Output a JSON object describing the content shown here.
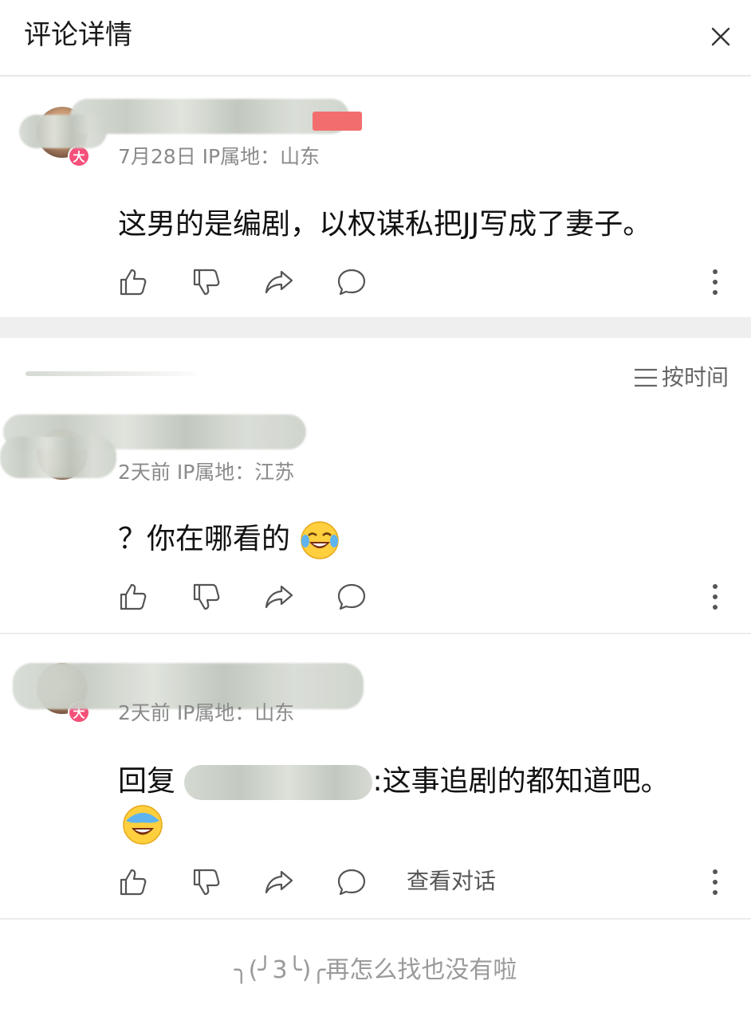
{
  "header": {
    "title": "评论详情"
  },
  "main_comment": {
    "meta": "7月28日 IP属地：山东",
    "text": "这男的是编剧，以权谋私把JJ写成了妻子。",
    "badge": "大"
  },
  "sort": {
    "label": "按时间"
  },
  "replies": [
    {
      "meta": "2天前 IP属地：江苏",
      "text": "？你在哪看的"
    },
    {
      "meta": "2天前 IP属地：山东",
      "reply_prefix": "回复 ",
      "text": ":这事追剧的都知道吧。",
      "badge": "大",
      "view_conversation": "查看对话"
    }
  ],
  "footer": {
    "text": "╮(╯3╰)╭再怎么找也没有啦"
  },
  "icons": [
    "like-icon",
    "dislike-icon",
    "share-icon",
    "comment-icon",
    "more-icon",
    "close-icon",
    "sort-icon"
  ],
  "colors": {
    "badge": "#f5507a",
    "mention": "#2c7fd6",
    "divider": "#efefef"
  }
}
